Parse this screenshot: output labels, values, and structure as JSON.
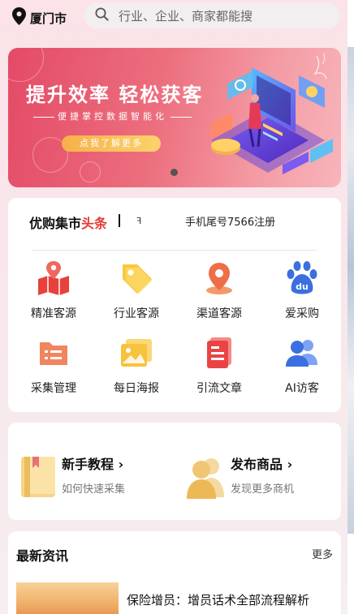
{
  "header": {
    "city": "厦门市",
    "search_placeholder": "行业、企业、商家都能搜"
  },
  "banner": {
    "title": "提升效率 轻松获客",
    "subtitle": "便捷掌控数据智能化",
    "cta": "点我了解更多"
  },
  "ticker": {
    "brand_prefix": "优购集市",
    "brand_highlight": "头条",
    "mini_glyph": "ꟻ",
    "message": "手机尾号7566注册"
  },
  "features": [
    {
      "label": "精准客源",
      "icon": "map-icon"
    },
    {
      "label": "行业客源",
      "icon": "tag-icon"
    },
    {
      "label": "渠道客源",
      "icon": "location-pin-icon"
    },
    {
      "label": "爱采购",
      "icon": "paw-du-icon"
    },
    {
      "label": "采集管理",
      "icon": "folder-list-icon"
    },
    {
      "label": "每日海报",
      "icon": "picture-icon"
    },
    {
      "label": "引流文章",
      "icon": "document-icon"
    },
    {
      "label": "AI访客",
      "icon": "users-icon"
    }
  ],
  "tutorials": {
    "left_title": "新手教程",
    "left_sub": "如何快速采集",
    "right_title": "发布商品",
    "right_sub": "发现更多商机"
  },
  "news": {
    "title": "最新资讯",
    "more": "更多",
    "headline": "保险增员：增员话术全部流程解析"
  },
  "colors": {
    "brand_red": "#e53935",
    "banner_start": "#e44a66",
    "cta_orange": "#f7b04a"
  }
}
